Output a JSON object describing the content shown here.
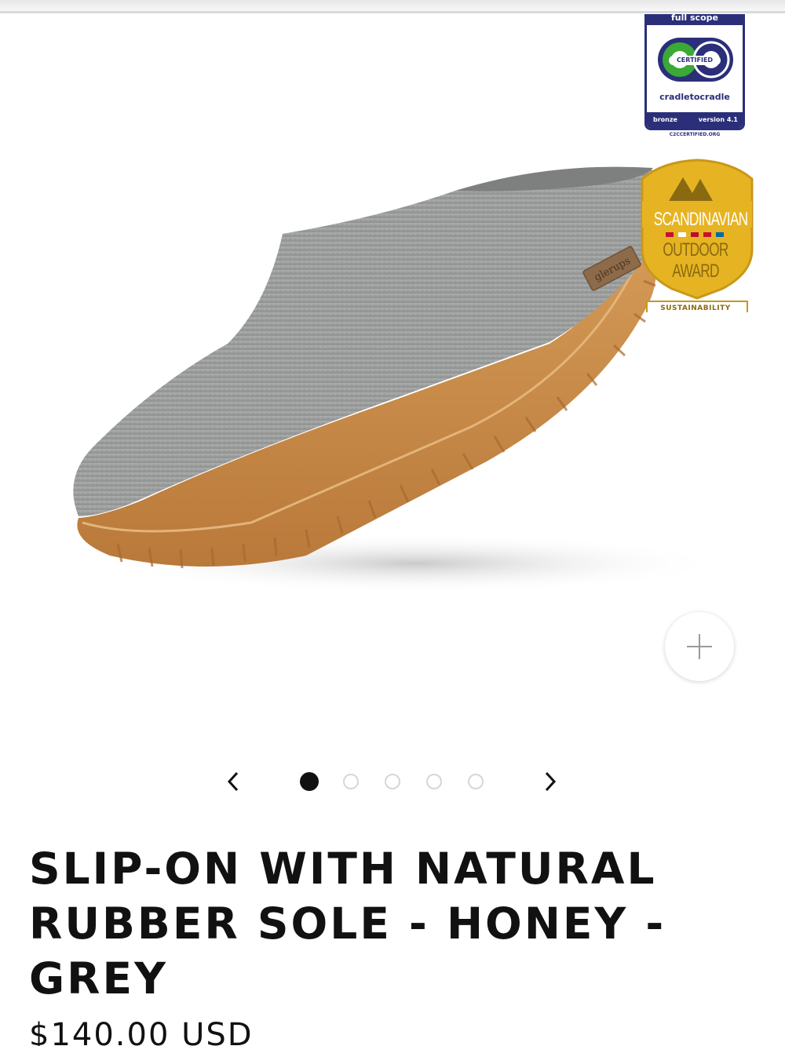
{
  "gallery": {
    "certification_badge": {
      "scope": "full scope",
      "certified": "CERTIFIED",
      "name": "cradletocradle",
      "level": "bronze",
      "version": "version 4.1",
      "url": "C2CCERTIFIED.ORG",
      "color": "#2b2f79"
    },
    "award_badge": {
      "line1": "SCANDINAVIAN",
      "line2": "OUTDOOR",
      "line3": "AWARD",
      "category": "SUSTAINABILITY",
      "color": "#e6b422"
    },
    "product_image": {
      "label_text": "glerups",
      "felt_color": "#9a9d9b",
      "sole_color": "#c98a47"
    },
    "zoom_icon": "plus-icon",
    "slide_count": 5,
    "active_slide": 1,
    "prev_icon": "chevron-left-icon",
    "next_icon": "chevron-right-icon"
  },
  "product": {
    "title": "SLIP-ON WITH NATURAL RUBBER SOLE - HONEY - GREY",
    "price": "$140.00 USD"
  }
}
